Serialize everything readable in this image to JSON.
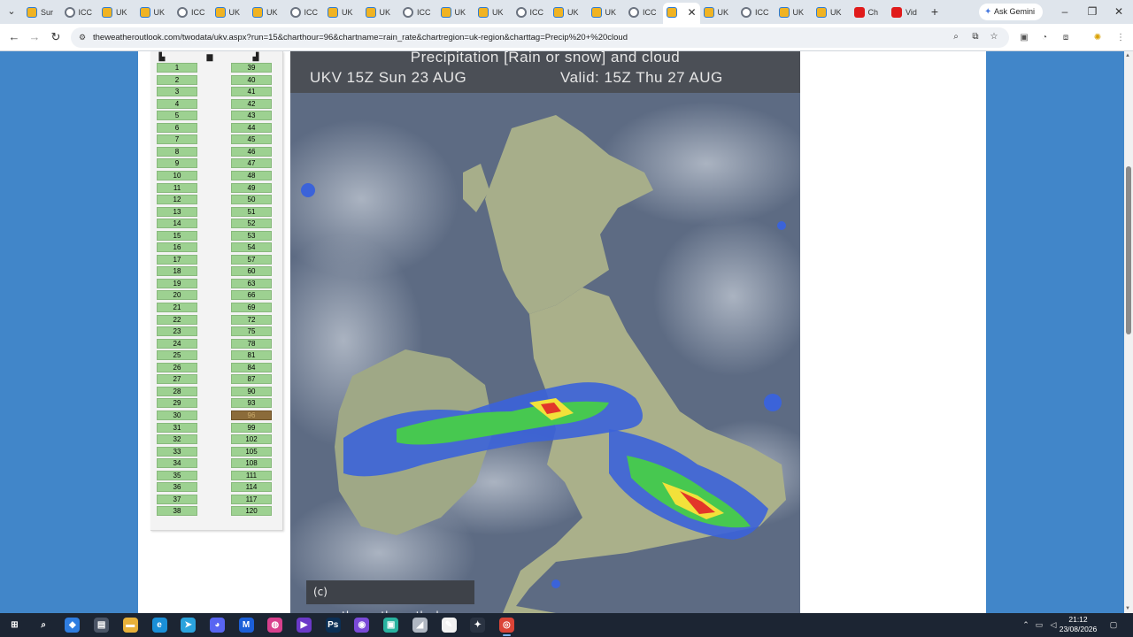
{
  "browser": {
    "tabs": [
      {
        "label": "Sur",
        "icon": "weather-cloud-icon"
      },
      {
        "label": "ICC",
        "icon": "globe-icon"
      },
      {
        "label": "UK",
        "icon": "weather-cloud-icon"
      },
      {
        "label": "UK",
        "icon": "weather-cloud-icon"
      },
      {
        "label": "ICC",
        "icon": "globe-icon"
      },
      {
        "label": "UK",
        "icon": "weather-cloud-icon"
      },
      {
        "label": "UK",
        "icon": "weather-cloud-icon"
      },
      {
        "label": "ICC",
        "icon": "globe-icon"
      },
      {
        "label": "UK",
        "icon": "weather-cloud-icon"
      },
      {
        "label": "UK",
        "icon": "weather-cloud-icon"
      },
      {
        "label": "ICC",
        "icon": "globe-icon"
      },
      {
        "label": "UK",
        "icon": "weather-cloud-icon"
      },
      {
        "label": "UK",
        "icon": "weather-cloud-icon"
      },
      {
        "label": "ICC",
        "icon": "globe-icon"
      },
      {
        "label": "UK",
        "icon": "weather-cloud-icon"
      },
      {
        "label": "UK",
        "icon": "weather-cloud-icon"
      },
      {
        "label": "ICC",
        "icon": "globe-icon"
      },
      {
        "label": "",
        "icon": "weather-cloud-icon",
        "active": true
      },
      {
        "label": "UK",
        "icon": "weather-cloud-icon"
      },
      {
        "label": "ICC",
        "icon": "globe-icon"
      },
      {
        "label": "UK",
        "icon": "weather-cloud-icon"
      },
      {
        "label": "UK",
        "icon": "weather-cloud-icon"
      },
      {
        "label": "Ch",
        "icon": "youtube-icon"
      },
      {
        "label": "Vid",
        "icon": "youtube-icon"
      }
    ],
    "close_tab_glyph": "✕",
    "new_tab_glyph": "+",
    "gemini_label": "Ask Gemini",
    "url": "theweatheroutlook.com/twodata/ukv.aspx?run=15&charthour=96&chartname=rain_rate&chartregion=uk-region&charttag=Precip%20+%20cloud"
  },
  "hours": {
    "col1": [
      "1",
      "2",
      "3",
      "4",
      "5",
      "6",
      "7",
      "8",
      "9",
      "10",
      "11",
      "12",
      "13",
      "14",
      "15",
      "16",
      "17",
      "18",
      "19",
      "20",
      "21",
      "22",
      "23",
      "24",
      "25",
      "26",
      "27",
      "28",
      "29",
      "30",
      "31",
      "32",
      "33",
      "34",
      "35",
      "36",
      "37",
      "38"
    ],
    "col2": [
      "39",
      "40",
      "41",
      "42",
      "43",
      "44",
      "45",
      "46",
      "47",
      "48",
      "49",
      "50",
      "51",
      "52",
      "53",
      "54",
      "57",
      "60",
      "63",
      "66",
      "69",
      "72",
      "75",
      "78",
      "81",
      "84",
      "87",
      "90",
      "93",
      "96",
      "99",
      "102",
      "105",
      "108",
      "111",
      "114",
      "117",
      "120"
    ],
    "selected": "96"
  },
  "chart": {
    "title": "Precipitation [Rain or snow] and cloud",
    "run": "UKV 15Z Sun 23 AUG",
    "valid": "Valid: 15Z Thu 27 AUG",
    "credit": "(c) www.theweatheroutlook.com"
  },
  "taskbar": {
    "apps": [
      {
        "name": "start-button",
        "glyph": "⊞",
        "color": "#1c2533"
      },
      {
        "name": "search-icon",
        "glyph": "⌕",
        "color": "#1c2533"
      },
      {
        "name": "copilot-icon",
        "glyph": "◆",
        "color": "#2f7de0"
      },
      {
        "name": "file-manager-icon",
        "glyph": "▤",
        "color": "#4b5566"
      },
      {
        "name": "folder-icon",
        "glyph": "▬",
        "color": "#e8b13a"
      },
      {
        "name": "edge-icon",
        "glyph": "e",
        "color": "#1a8fd8"
      },
      {
        "name": "telegram-icon",
        "glyph": "➤",
        "color": "#2aa3dd"
      },
      {
        "name": "discord-icon",
        "glyph": "◕",
        "color": "#5865f2"
      },
      {
        "name": "malwarebytes-icon",
        "glyph": "M",
        "color": "#1c5fd8"
      },
      {
        "name": "app-icon-1",
        "glyph": "◍",
        "color": "#d9408d"
      },
      {
        "name": "media-icon",
        "glyph": "▶",
        "color": "#6b39c8"
      },
      {
        "name": "photoshop-icon",
        "glyph": "Ps",
        "color": "#0b2f55"
      },
      {
        "name": "app-icon-2",
        "glyph": "◉",
        "color": "#7a4ad8"
      },
      {
        "name": "app-icon-3",
        "glyph": "▣",
        "color": "#28b3a0"
      },
      {
        "name": "app-icon-4",
        "glyph": "◢",
        "color": "#b0b7c2"
      },
      {
        "name": "draw-icon",
        "glyph": "✎",
        "color": "#f2f2f2"
      },
      {
        "name": "app-icon-5",
        "glyph": "✦",
        "color": "#2a3342"
      },
      {
        "name": "chrome-icon",
        "glyph": "◎",
        "color": "#db4437",
        "active": true
      }
    ],
    "time": "21:12",
    "date": "23/08/2026"
  }
}
